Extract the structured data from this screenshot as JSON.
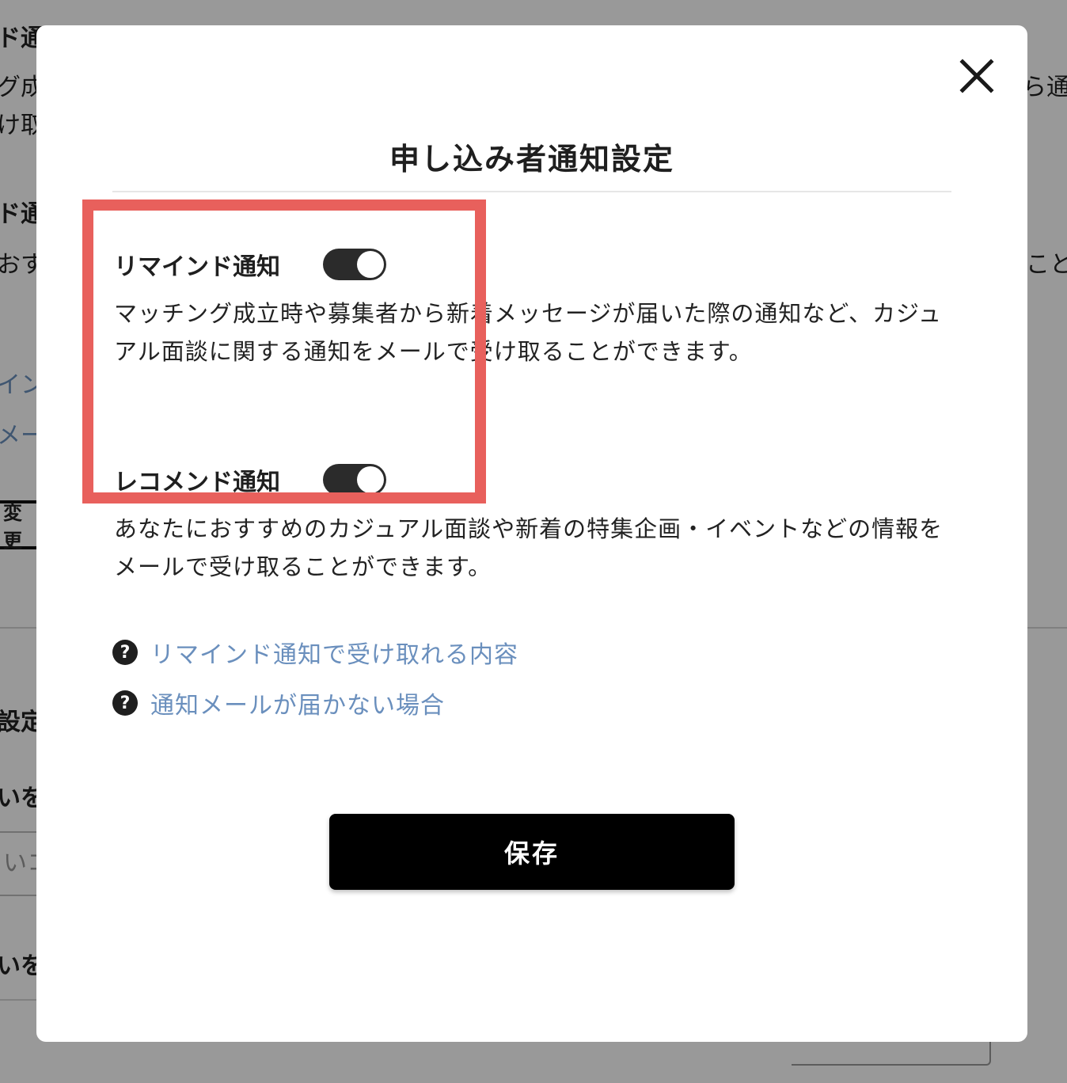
{
  "background": {
    "fragments": [
      {
        "text": "ド通",
        "bold": true
      },
      {
        "text": "グ成",
        "bold": false
      },
      {
        "text": "け取",
        "bold": false
      },
      {
        "text": "ド通",
        "bold": true
      },
      {
        "text": "おす",
        "bold": false
      },
      {
        "text": "イン",
        "bold": false,
        "blue": true
      },
      {
        "text": "メー",
        "bold": false,
        "blue": true
      },
      {
        "text": "設定",
        "bold": true
      },
      {
        "text": "いを",
        "bold": true
      },
      {
        "text": "いコ",
        "bold": false
      },
      {
        "text": "いを",
        "bold": true
      },
      {
        "text": "ら通知",
        "bold": false
      },
      {
        "text": "こと",
        "bold": false
      }
    ],
    "change_button_label": "変更"
  },
  "modal": {
    "title": "申し込み者通知設定",
    "close_icon": "close-icon",
    "settings": [
      {
        "label": "リマインド通知",
        "enabled": true,
        "description": "マッチング成立時や募集者から新着メッセージが届いた際の通知など、カジュアル面談に関する通知をメールで受け取ることができます。"
      },
      {
        "label": "レコメンド通知",
        "enabled": true,
        "description": "あなたにおすすめのカジュアル面談や新着の特集企画・イベントなどの情報をメールで受け取ることができます。"
      }
    ],
    "help_links": [
      {
        "icon": "question-circle-icon",
        "glyph": "?",
        "text": "リマインド通知で受け取れる内容"
      },
      {
        "icon": "question-circle-icon",
        "glyph": "?",
        "text": "通知メールが届かない場合"
      }
    ],
    "save_label": "保存"
  },
  "colors": {
    "highlight": "#e8605c",
    "link": "#6a8fbd",
    "toggle_on": "#2b2b2b",
    "button": "#000000",
    "overlay": "rgba(0,0,0,0.4)"
  }
}
